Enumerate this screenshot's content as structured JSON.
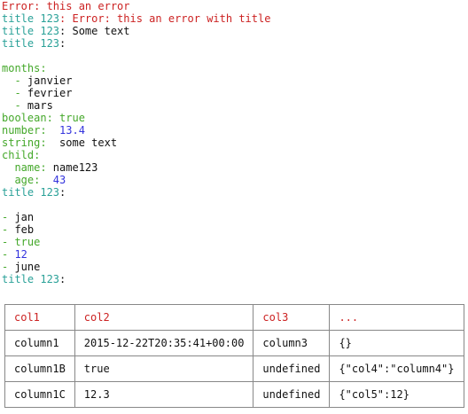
{
  "lines": [
    {
      "parts": [
        {
          "text": "Error: this an error",
          "color": "red"
        }
      ]
    },
    {
      "parts": [
        {
          "text": "title 123",
          "color": "cyan"
        },
        {
          "text": ": Error: this an error with title",
          "color": "red"
        }
      ]
    },
    {
      "parts": [
        {
          "text": "title 123",
          "color": "cyan"
        },
        {
          "text": ": Some text",
          "color": "dark"
        }
      ]
    },
    {
      "parts": [
        {
          "text": "title 123",
          "color": "cyan"
        },
        {
          "text": ":",
          "color": "dark"
        }
      ]
    },
    {
      "parts": [
        {
          "text": "",
          "color": "dark"
        }
      ]
    },
    {
      "parts": [
        {
          "text": "months:",
          "color": "green"
        }
      ]
    },
    {
      "parts": [
        {
          "text": "  - ",
          "color": "green"
        },
        {
          "text": "janvier",
          "color": "dark"
        }
      ]
    },
    {
      "parts": [
        {
          "text": "  - ",
          "color": "green"
        },
        {
          "text": "fevrier",
          "color": "dark"
        }
      ]
    },
    {
      "parts": [
        {
          "text": "  - ",
          "color": "green"
        },
        {
          "text": "mars",
          "color": "dark"
        }
      ]
    },
    {
      "parts": [
        {
          "text": "boolean: ",
          "color": "green"
        },
        {
          "text": "true",
          "color": "green"
        }
      ]
    },
    {
      "parts": [
        {
          "text": "number:  ",
          "color": "green"
        },
        {
          "text": "13.4",
          "color": "blue"
        }
      ]
    },
    {
      "parts": [
        {
          "text": "string:  ",
          "color": "green"
        },
        {
          "text": "some text",
          "color": "dark"
        }
      ]
    },
    {
      "parts": [
        {
          "text": "child:",
          "color": "green"
        }
      ]
    },
    {
      "parts": [
        {
          "text": "  name: ",
          "color": "green"
        },
        {
          "text": "name123",
          "color": "dark"
        }
      ]
    },
    {
      "parts": [
        {
          "text": "  age:  ",
          "color": "green"
        },
        {
          "text": "43",
          "color": "blue"
        }
      ]
    },
    {
      "parts": [
        {
          "text": "title 123",
          "color": "cyan"
        },
        {
          "text": ":",
          "color": "dark"
        }
      ]
    },
    {
      "parts": [
        {
          "text": "",
          "color": "dark"
        }
      ]
    },
    {
      "parts": [
        {
          "text": "- ",
          "color": "green"
        },
        {
          "text": "jan",
          "color": "dark"
        }
      ]
    },
    {
      "parts": [
        {
          "text": "- ",
          "color": "green"
        },
        {
          "text": "feb",
          "color": "dark"
        }
      ]
    },
    {
      "parts": [
        {
          "text": "- ",
          "color": "green"
        },
        {
          "text": "true",
          "color": "green"
        }
      ]
    },
    {
      "parts": [
        {
          "text": "- ",
          "color": "green"
        },
        {
          "text": "12",
          "color": "blue"
        }
      ]
    },
    {
      "parts": [
        {
          "text": "- ",
          "color": "green"
        },
        {
          "text": "june",
          "color": "dark"
        }
      ]
    },
    {
      "parts": [
        {
          "text": "title 123",
          "color": "cyan"
        },
        {
          "text": ":",
          "color": "dark"
        }
      ]
    }
  ],
  "table": {
    "headers": [
      "col1",
      "col2",
      "col3",
      "..."
    ],
    "rows": [
      [
        "column1",
        "2015-12-22T20:35:41+00:00",
        "column3",
        "{}"
      ],
      [
        "column1B",
        "true",
        "undefined",
        "{\"col4\":\"column4\"}"
      ],
      [
        "column1C",
        "12.3",
        "undefined",
        "{\"col5\":12}"
      ]
    ]
  },
  "colors": {
    "red": "#cc2222",
    "cyan": "#2aa198",
    "green": "#44a82a",
    "blue": "#3333dd",
    "dark": "#111111"
  }
}
